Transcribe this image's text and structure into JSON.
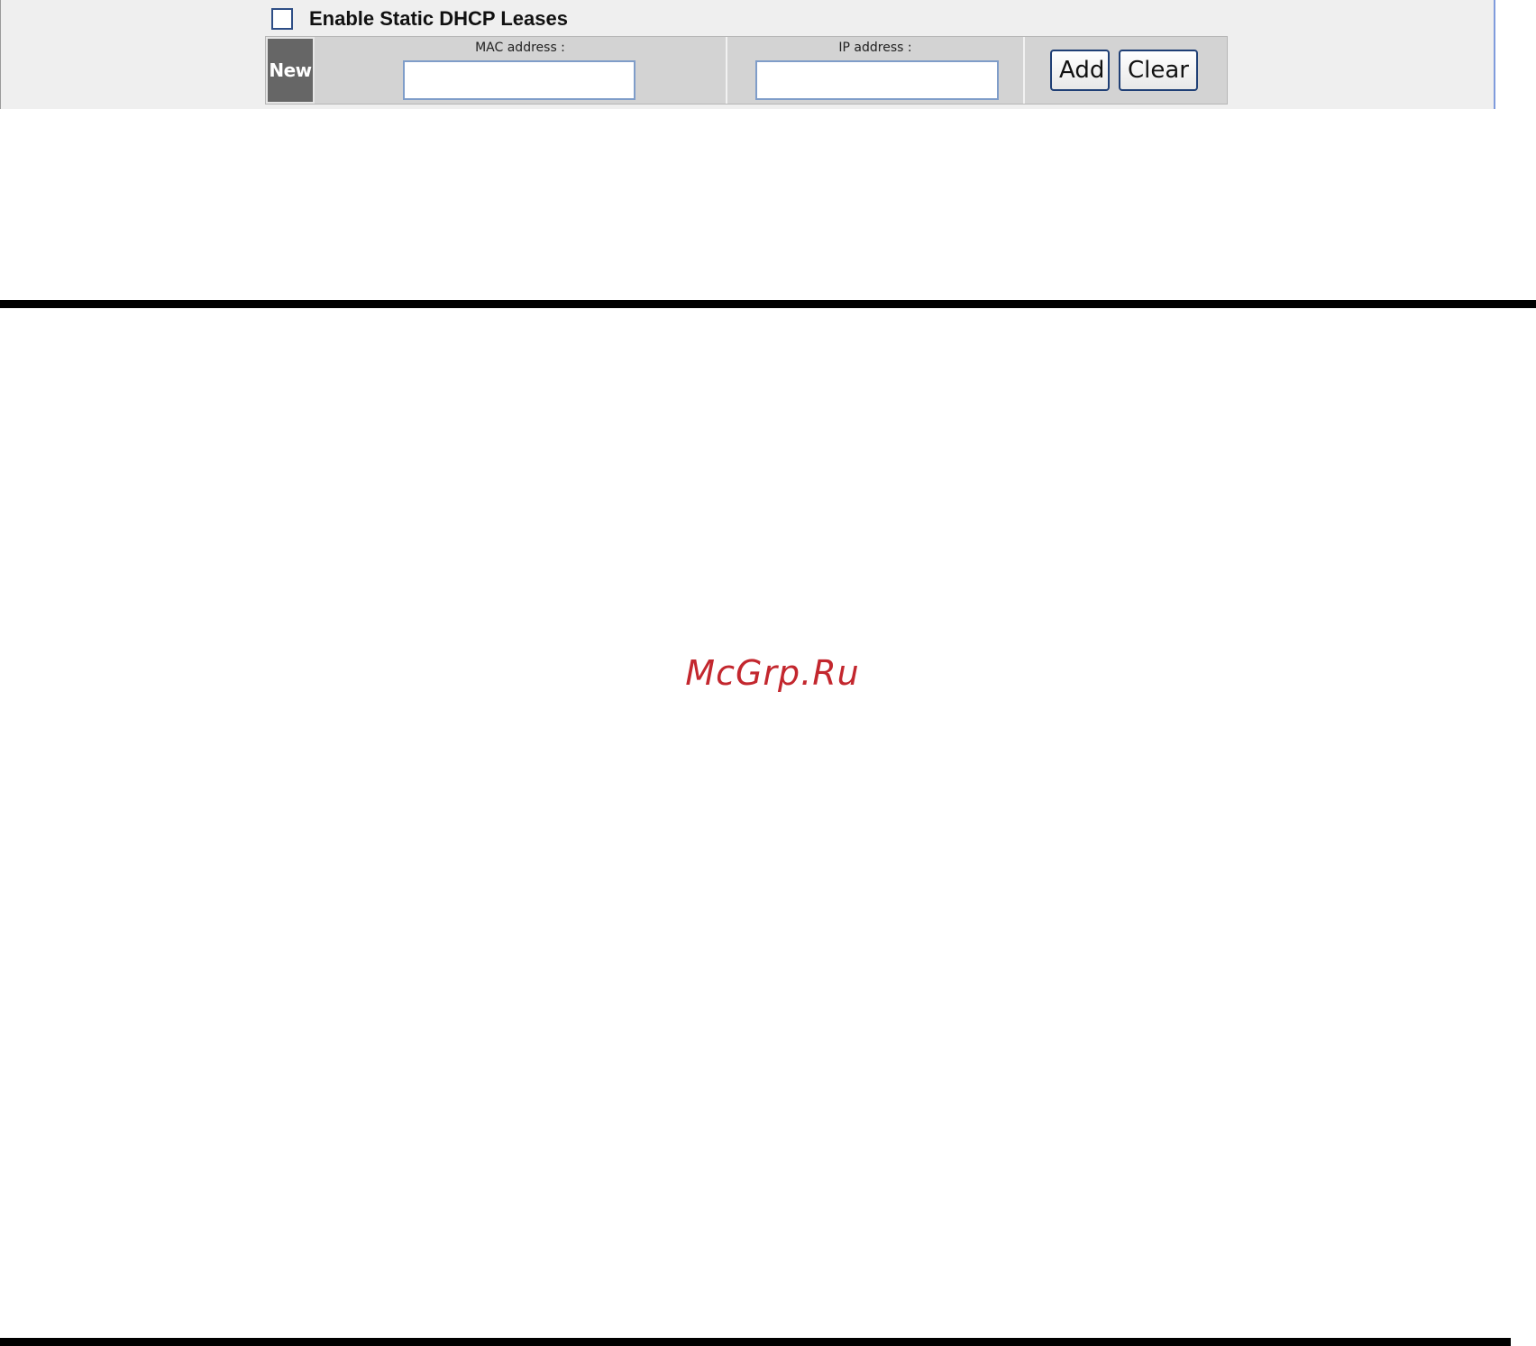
{
  "static_dhcp": {
    "enable_label": "Enable Static DHCP Leases",
    "enabled": false,
    "new_label": "New",
    "mac": {
      "label": "MAC address :",
      "value": ""
    },
    "ip": {
      "label": "IP address :",
      "value": ""
    },
    "add_label": "Add",
    "clear_label": "Clear"
  },
  "watermark": "McGrp.Ru",
  "colors": {
    "panel_bg": "#efefef",
    "table_bg": "#d3d3d3",
    "new_bg": "#666666",
    "input_border": "#7f9dc9",
    "button_border": "#1f3f75",
    "watermark": "#c3272e"
  }
}
